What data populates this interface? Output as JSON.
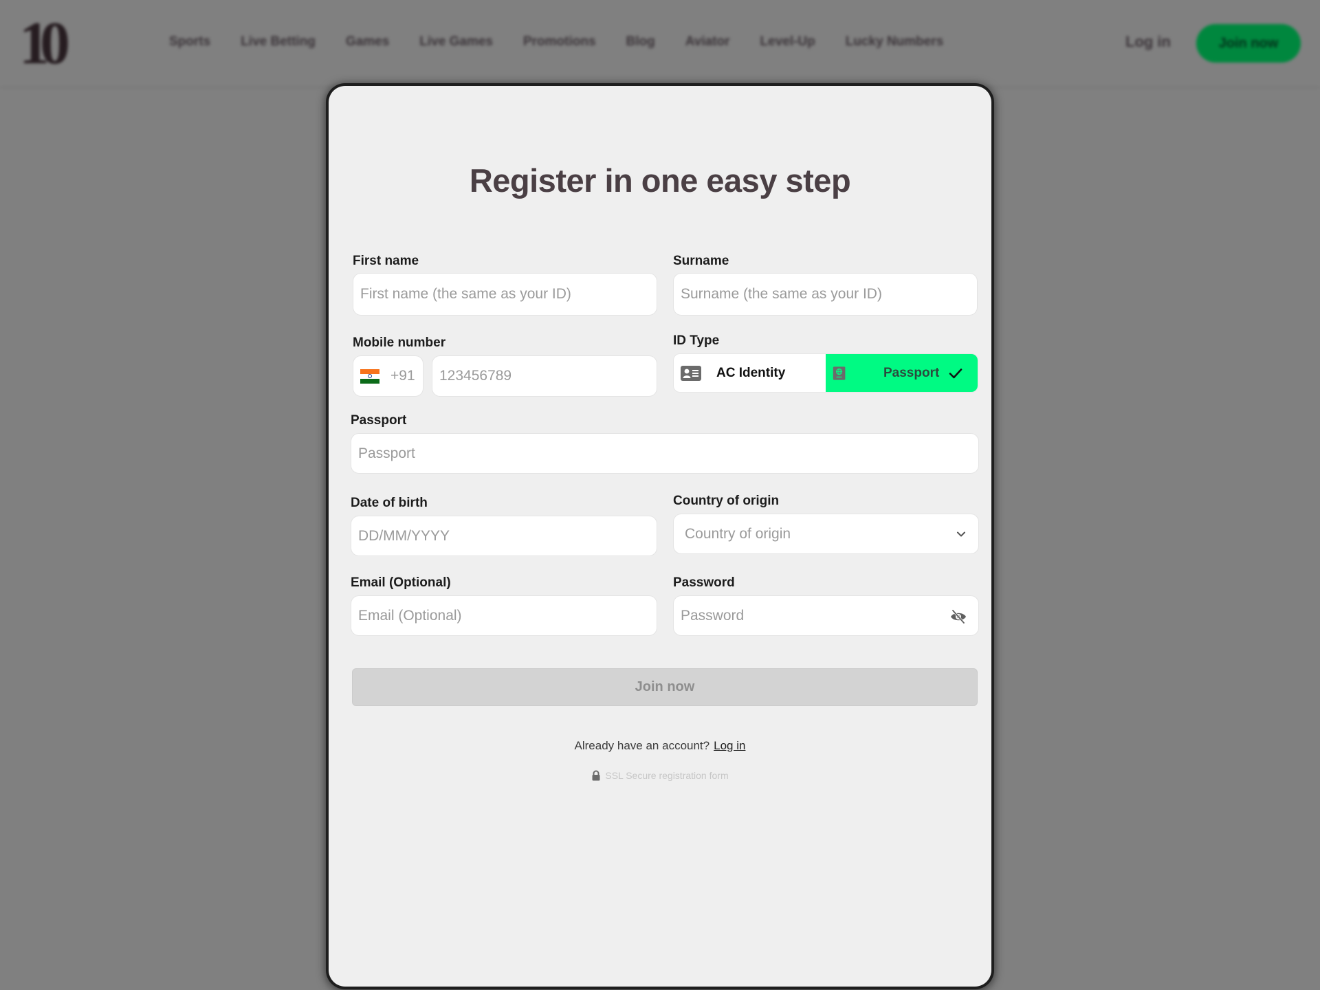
{
  "header": {
    "logo_text": "10",
    "nav": [
      "Sports",
      "Live Betting",
      "Games",
      "Live Games",
      "Promotions",
      "Blog",
      "Aviator",
      "Level-Up",
      "Lucky Numbers"
    ],
    "login_label": "Log in",
    "join_label": "Join now",
    "join_color": "#00873e"
  },
  "modal": {
    "title": "Register in one easy step",
    "first_name": {
      "label": "First name",
      "placeholder": "First name (the same as your ID)"
    },
    "surname": {
      "label": "Surname",
      "placeholder": "Surname (the same as your ID)"
    },
    "mobile": {
      "label": "Mobile number",
      "country_code": "+91",
      "flag": "india-flag",
      "placeholder": "123456789"
    },
    "id_type": {
      "label": "ID Type",
      "options": [
        {
          "label": "AC Identity",
          "icon": "id-card-icon",
          "selected": false
        },
        {
          "label": "Passport",
          "icon": "passport-icon",
          "selected": true
        }
      ],
      "selected_color": "#00fa83"
    },
    "passport": {
      "label": "Passport",
      "placeholder": "Passport"
    },
    "dob": {
      "label": "Date of birth",
      "placeholder": "DD/MM/YYYY"
    },
    "country": {
      "label": "Country of origin",
      "placeholder": "Country of origin"
    },
    "email": {
      "label": "Email (Optional)",
      "placeholder": "Email (Optional)"
    },
    "password": {
      "label": "Password",
      "placeholder": "Password"
    },
    "join_button": "Join now",
    "already_text": "Already have an account?",
    "login_link": "Log in",
    "ssl_text": "SSL Secure registration form"
  }
}
